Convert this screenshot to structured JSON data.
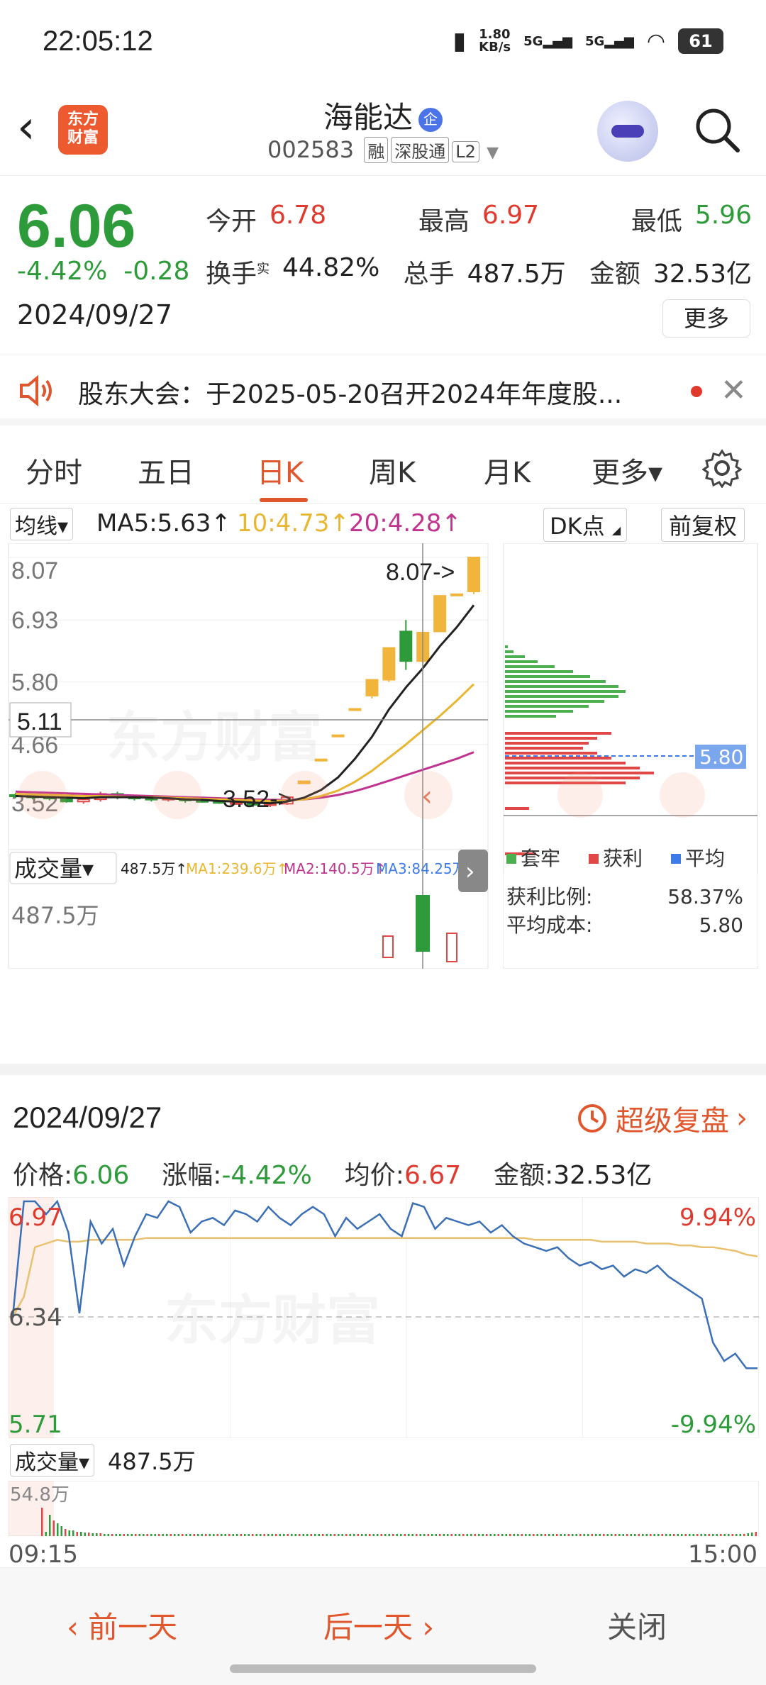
{
  "status_bar": {
    "time": "22:05:12",
    "speed": "1.80\nKB/s",
    "net1": "5G",
    "net2": "5G",
    "battery": "61"
  },
  "header": {
    "app_logo": "东方\n财富",
    "stock_name": "海能达",
    "stock_badge": "企",
    "code": "002583",
    "tags": [
      "融",
      "深股通",
      "L2"
    ]
  },
  "quote": {
    "price": "6.06",
    "change_pct": "-4.42%",
    "change_amt": "-0.28",
    "date": "2024/09/27",
    "fields": [
      [
        {
          "label": "今开",
          "value": "6.78",
          "color": "#e03a2e"
        },
        {
          "label": "最高",
          "value": "6.97",
          "color": "#e03a2e"
        },
        {
          "label": "最低",
          "value": "5.96",
          "color": "#2e9b3a"
        }
      ],
      [
        {
          "label": "换手",
          "value": "44.82%",
          "color": "#333333"
        },
        {
          "label": "总手",
          "value": "487.5万",
          "color": "#333333"
        },
        {
          "label": "金额",
          "value": "32.53亿",
          "color": "#333333"
        }
      ]
    ],
    "turnover_sup": "实",
    "more": "更多"
  },
  "notice": {
    "text": "股东大会：于2025-05-20召开2024年年度股..."
  },
  "tabs": [
    {
      "label": "分时",
      "active": false
    },
    {
      "label": "五日",
      "active": false
    },
    {
      "label": "日K",
      "active": true
    },
    {
      "label": "周K",
      "active": false
    },
    {
      "label": "月K",
      "active": false
    },
    {
      "label": "更多▾",
      "active": false
    }
  ],
  "ma_bar": {
    "selector": "均线▾",
    "ma5": "MA5:5.63↑",
    "ma10": "10:4.73↑",
    "ma20": "20:4.28↑",
    "dk": "DK点",
    "fq": "前复权"
  },
  "kchart": {
    "axis_labels": [
      "8.07",
      "6.93",
      "5.80",
      "4.66",
      "3.52"
    ],
    "crosshair_value": "5.11",
    "max_label": "8.07->",
    "min_label": "3.52->",
    "watermark": "东方财富",
    "candles": [
      {
        "o": 3.74,
        "h": 3.78,
        "l": 3.68,
        "c": 3.72
      },
      {
        "o": 3.72,
        "h": 3.76,
        "l": 3.66,
        "c": 3.7
      },
      {
        "o": 3.7,
        "h": 3.74,
        "l": 3.64,
        "c": 3.68
      },
      {
        "o": 3.68,
        "h": 3.7,
        "l": 3.6,
        "c": 3.62
      },
      {
        "o": 3.62,
        "h": 3.68,
        "l": 3.58,
        "c": 3.66
      },
      {
        "o": 3.66,
        "h": 3.8,
        "l": 3.62,
        "c": 3.76
      },
      {
        "o": 3.76,
        "h": 3.8,
        "l": 3.66,
        "c": 3.7
      },
      {
        "o": 3.7,
        "h": 3.74,
        "l": 3.64,
        "c": 3.68
      },
      {
        "o": 3.68,
        "h": 3.7,
        "l": 3.62,
        "c": 3.66
      },
      {
        "o": 3.66,
        "h": 3.72,
        "l": 3.62,
        "c": 3.68
      },
      {
        "o": 3.68,
        "h": 3.7,
        "l": 3.6,
        "c": 3.64
      },
      {
        "o": 3.64,
        "h": 3.68,
        "l": 3.6,
        "c": 3.62
      },
      {
        "o": 3.62,
        "h": 3.66,
        "l": 3.58,
        "c": 3.6
      },
      {
        "o": 3.6,
        "h": 3.64,
        "l": 3.56,
        "c": 3.6
      },
      {
        "o": 3.6,
        "h": 3.62,
        "l": 3.52,
        "c": 3.56
      },
      {
        "o": 3.56,
        "h": 3.6,
        "l": 3.52,
        "c": 3.58
      },
      {
        "o": 3.58,
        "h": 3.72,
        "l": 3.56,
        "c": 3.7
      },
      {
        "o": 3.95,
        "h": 3.99,
        "l": 3.95,
        "c": 3.99
      },
      {
        "o": 4.39,
        "h": 4.39,
        "l": 4.39,
        "c": 4.39
      },
      {
        "o": 4.83,
        "h": 4.83,
        "l": 4.83,
        "c": 4.83
      },
      {
        "o": 5.31,
        "h": 5.31,
        "l": 5.31,
        "c": 5.31
      },
      {
        "o": 5.55,
        "h": 5.84,
        "l": 5.5,
        "c": 5.84
      },
      {
        "o": 5.84,
        "h": 6.42,
        "l": 5.8,
        "c": 6.42
      },
      {
        "o": 6.72,
        "h": 6.93,
        "l": 6.02,
        "c": 6.18
      },
      {
        "o": 6.18,
        "h": 6.72,
        "l": 6.1,
        "c": 6.7
      },
      {
        "o": 6.72,
        "h": 7.37,
        "l": 6.72,
        "c": 7.37
      },
      {
        "o": 7.4,
        "h": 7.4,
        "l": 7.4,
        "c": 7.4
      },
      {
        "o": 7.45,
        "h": 8.07,
        "l": 7.4,
        "c": 8.07
      }
    ],
    "ma5": [
      3.72,
      3.71,
      3.7,
      3.69,
      3.68,
      3.7,
      3.7,
      3.7,
      3.69,
      3.68,
      3.66,
      3.65,
      3.63,
      3.62,
      3.6,
      3.59,
      3.62,
      3.69,
      3.83,
      4.06,
      4.4,
      4.8,
      5.3,
      5.7,
      6.05,
      6.45,
      6.8,
      7.2
    ],
    "ma10": [
      3.76,
      3.75,
      3.74,
      3.73,
      3.72,
      3.72,
      3.71,
      3.7,
      3.7,
      3.69,
      3.68,
      3.67,
      3.66,
      3.65,
      3.64,
      3.63,
      3.64,
      3.66,
      3.72,
      3.82,
      3.98,
      4.18,
      4.42,
      4.66,
      4.92,
      5.18,
      5.46,
      5.76
    ],
    "ma20": [
      3.8,
      3.79,
      3.78,
      3.77,
      3.76,
      3.75,
      3.74,
      3.73,
      3.72,
      3.71,
      3.7,
      3.69,
      3.68,
      3.67,
      3.66,
      3.65,
      3.65,
      3.66,
      3.69,
      3.74,
      3.81,
      3.9,
      4.0,
      4.1,
      4.2,
      4.3,
      4.4,
      4.52
    ],
    "volume_bar": {
      "selector": "成交量▾",
      "vol": "487.5万↑",
      "ma1": "MA1:239.6万↑",
      "ma2": "MA2:140.5万↑",
      "ma3": "MA3:84.25万↑",
      "axis": "487.5万"
    }
  },
  "profile": {
    "avg_label": "5.80",
    "legend": [
      "套牢",
      "获利",
      "平均"
    ],
    "colors": {
      "trapped": "#4caf50",
      "profit": "#e04848",
      "avg": "#3c7be8"
    },
    "profit_ratio_label": "获利比例:",
    "profit_ratio": "58.37%",
    "avg_cost_label": "平均成本:",
    "avg_cost": "5.80"
  },
  "detail": {
    "date": "2024/09/27",
    "replay": "超级复盘",
    "stats": [
      {
        "label": "价格:",
        "value": "6.06",
        "color": "#2e9b3a"
      },
      {
        "label": "涨幅:",
        "value": "-4.42%",
        "color": "#2e9b3a"
      },
      {
        "label": "均价:",
        "value": "6.67",
        "color": "#e03a2e"
      },
      {
        "label": "金额:",
        "value": "32.53亿",
        "color": "#222222"
      }
    ],
    "intraday": {
      "top": "6.97",
      "mid": "6.34",
      "bottom": "5.71",
      "top_pct": "9.94%",
      "bottom_pct": "-9.94%",
      "price": [
        6.34,
        6.97,
        6.97,
        6.9,
        6.97,
        6.8,
        6.36,
        6.86,
        6.74,
        6.82,
        6.62,
        6.78,
        6.9,
        6.88,
        6.97,
        6.94,
        6.8,
        6.86,
        6.88,
        6.84,
        6.92,
        6.9,
        6.86,
        6.94,
        6.88,
        6.84,
        6.9,
        6.94,
        6.9,
        6.78,
        6.88,
        6.82,
        6.86,
        6.9,
        6.82,
        6.78,
        6.96,
        6.94,
        6.82,
        6.88,
        6.86,
        6.84,
        6.86,
        6.8,
        6.84,
        6.78,
        6.74,
        6.72,
        6.7,
        6.72,
        6.66,
        6.62,
        6.64,
        6.6,
        6.62,
        6.56,
        6.6,
        6.58,
        6.62,
        6.56,
        6.52,
        6.48,
        6.44,
        6.2,
        6.1,
        6.14,
        6.06,
        6.06
      ],
      "avg": [
        6.34,
        6.45,
        6.72,
        6.74,
        6.76,
        6.75,
        6.75,
        6.76,
        6.76,
        6.76,
        6.76,
        6.76,
        6.77,
        6.77,
        6.77,
        6.77,
        6.77,
        6.77,
        6.77,
        6.77,
        6.77,
        6.77,
        6.77,
        6.77,
        6.77,
        6.77,
        6.77,
        6.77,
        6.77,
        6.77,
        6.77,
        6.77,
        6.77,
        6.77,
        6.77,
        6.77,
        6.77,
        6.77,
        6.77,
        6.77,
        6.77,
        6.77,
        6.77,
        6.77,
        6.77,
        6.77,
        6.77,
        6.76,
        6.76,
        6.76,
        6.76,
        6.76,
        6.76,
        6.75,
        6.75,
        6.75,
        6.75,
        6.74,
        6.74,
        6.74,
        6.73,
        6.73,
        6.72,
        6.72,
        6.71,
        6.7,
        6.68,
        6.67
      ],
      "watermark": "东方财富"
    },
    "volume": {
      "selector": "成交量▾",
      "value": "487.5万",
      "axis": "54.8万"
    },
    "time_start": "09:15",
    "time_end": "15:00"
  },
  "bottom": {
    "prev": "前一天",
    "next": "后一天",
    "close": "关闭"
  }
}
